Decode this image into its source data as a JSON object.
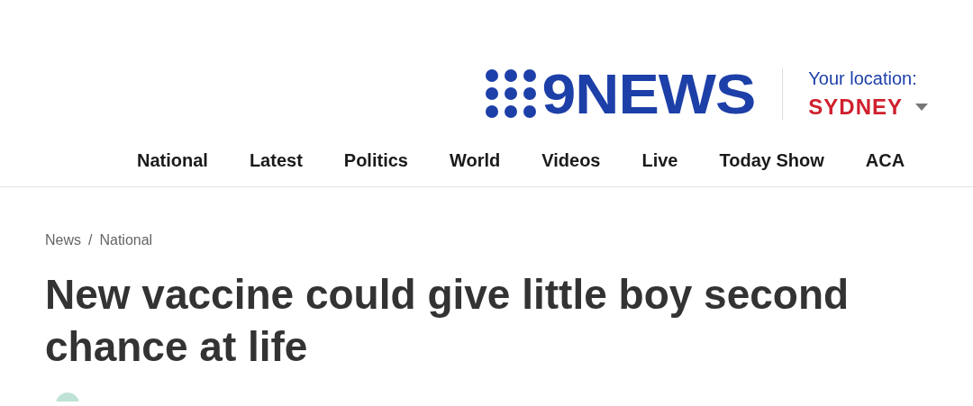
{
  "logo": {
    "text": "9NEWS"
  },
  "location": {
    "label": "Your location:",
    "city": "SYDNEY"
  },
  "nav": [
    {
      "label": "National"
    },
    {
      "label": "Latest"
    },
    {
      "label": "Politics"
    },
    {
      "label": "World"
    },
    {
      "label": "Videos"
    },
    {
      "label": "Live"
    },
    {
      "label": "Today Show"
    },
    {
      "label": "ACA"
    }
  ],
  "breadcrumb": [
    "News",
    "/",
    "National"
  ],
  "headline": "New vaccine could give little boy second chance at life"
}
